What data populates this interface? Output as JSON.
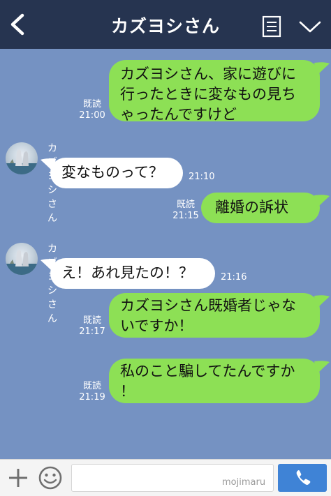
{
  "header": {
    "title": "カズヨシさん",
    "back_icon": "chevron-left-icon",
    "menu_icon": "note-list-icon",
    "more_icon": "chevron-down-icon",
    "bg_color": "#263450"
  },
  "chat": {
    "bg_color": "#7592c2",
    "sent_bubble_color": "#8de055",
    "received_bubble_color": "#ffffff",
    "messages": [
      {
        "direction": "sent",
        "lines": [
          "カズヨシさん、家に遊びに",
          "行ったときに変なもの見ち",
          "ゃったんですけど"
        ],
        "read_label": "既読",
        "time": "21:00"
      },
      {
        "direction": "received",
        "sender": "カズヨシさん",
        "lines": [
          "変なものって？"
        ],
        "time": "21:10"
      },
      {
        "direction": "sent",
        "lines": [
          "離婚の訴状"
        ],
        "read_label": "既読",
        "time": "21:15"
      },
      {
        "direction": "received",
        "sender": "カズヨシさん",
        "lines": [
          "え！あれ見たの！？"
        ],
        "time": "21:16"
      },
      {
        "direction": "sent",
        "lines": [
          "カズヨシさん既婚者じゃな",
          "いですか！"
        ],
        "read_label": "既読",
        "time": "21:17"
      },
      {
        "direction": "sent",
        "lines": [
          "私のこと騙してたんですか",
          "！"
        ],
        "read_label": "既読",
        "time": "21:19"
      }
    ]
  },
  "input_bar": {
    "plus_icon": "plus-icon",
    "emoji_icon": "smiley-icon",
    "placeholder": "",
    "watermark": "mojimaru",
    "call_icon": "phone-icon",
    "call_color": "#3f83d6"
  }
}
